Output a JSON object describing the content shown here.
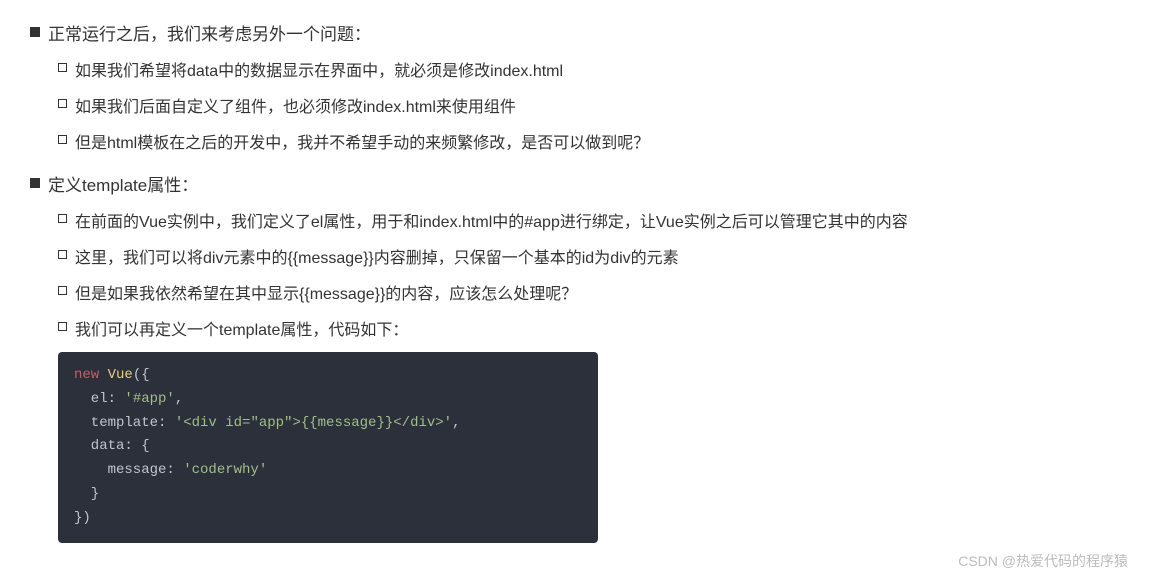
{
  "sections": [
    {
      "heading": "正常运行之后，我们来考虑另外一个问题：",
      "items": [
        "如果我们希望将data中的数据显示在界面中，就必须是修改index.html",
        "如果我们后面自定义了组件，也必须修改index.html来使用组件",
        "但是html模板在之后的开发中，我并不希望手动的来频繁修改，是否可以做到呢？"
      ]
    },
    {
      "heading": "定义template属性：",
      "items": [
        "在前面的Vue实例中，我们定义了el属性，用于和index.html中的#app进行绑定，让Vue实例之后可以管理它其中的内容",
        "这里，我们可以将div元素中的{{message}}内容删掉，只保留一个基本的id为div的元素",
        "但是如果我依然希望在其中显示{{message}}的内容，应该怎么处理呢？",
        "我们可以再定义一个template属性，代码如下："
      ]
    }
  ],
  "code": {
    "kw_new": "new",
    "kw_vue": "Vue",
    "paren_open": "({",
    "line_el_prop": "  el: ",
    "line_el_val": "'#app'",
    "comma": ",",
    "line_tpl_prop": "  template: ",
    "line_tpl_val": "'<div id=\"app\">{{message}}</div>'",
    "line_data_prop": "  data: {",
    "line_msg_prop": "    message: ",
    "line_msg_val": "'coderwhy'",
    "line_brace_close": "  }",
    "line_end": "})"
  },
  "watermark": "CSDN @热爱代码的程序猿"
}
